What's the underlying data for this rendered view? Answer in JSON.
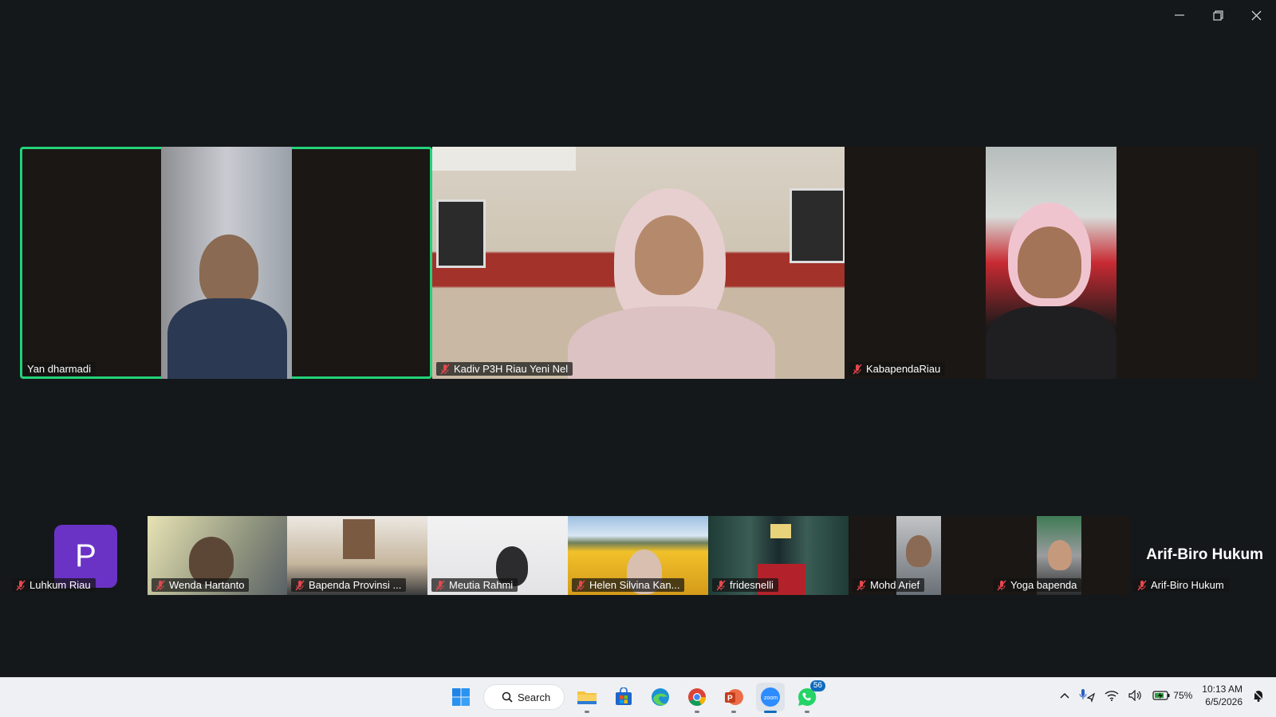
{
  "window": {
    "controls": {
      "minimize": "minimize-icon",
      "restore": "restore-icon",
      "close": "close-icon"
    }
  },
  "top_row": [
    {
      "name": "Yan dharmadi",
      "muted": false,
      "active": true
    },
    {
      "name": "Kadiv P3H Riau Yeni Nel",
      "muted": true,
      "active": false
    },
    {
      "name": "KabapendaRiau",
      "muted": true,
      "active": false
    }
  ],
  "bottom_row": [
    {
      "name": "Luhkum Riau",
      "avatar_letter": "P",
      "muted": true
    },
    {
      "name": "Wenda Hartanto",
      "muted": true
    },
    {
      "name": "Bapenda Provinsi ...",
      "muted": true
    },
    {
      "name": "Meutia Rahmi",
      "muted": true
    },
    {
      "name": "Helen Silvina Kan...",
      "muted": true
    },
    {
      "name": "fridesnelli",
      "muted": true
    },
    {
      "name": "Mohd Arief",
      "muted": true
    },
    {
      "name": "Yoga bapenda",
      "muted": true
    },
    {
      "name": "Arif-Biro Hukum",
      "big_label": "Arif-Biro Hukum",
      "muted": true
    }
  ],
  "taskbar": {
    "search_label": "Search",
    "apps": [
      "windows-start",
      "file-explorer",
      "microsoft-store",
      "edge",
      "chrome",
      "powerpoint",
      "zoom",
      "whatsapp"
    ],
    "whatsapp_badge": "56",
    "battery": "75%",
    "time": "10:13 AM",
    "date": "6/5/2026"
  },
  "colors": {
    "active_speaker": "#22d37a",
    "avatar": "#6b32c6",
    "taskbar": "#eef0f3"
  }
}
